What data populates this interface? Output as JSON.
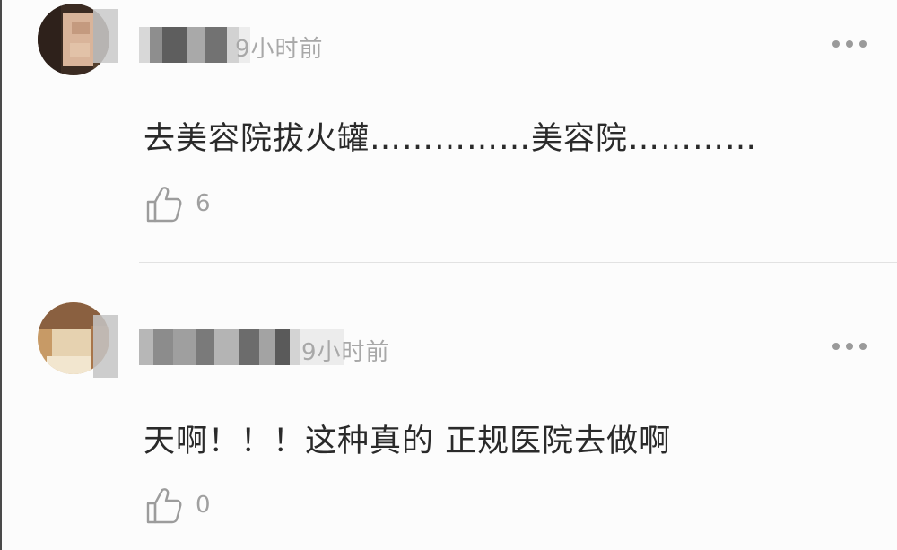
{
  "comments": [
    {
      "time": "9小时前",
      "content": "去美容院拔火罐……………美容院…………",
      "likes": "6",
      "more_icon": "ellipsis-icon",
      "like_icon": "thumbs-up-icon"
    },
    {
      "time": "9小时前",
      "content": "天啊！！！这种真的 正规医院去做啊",
      "likes": "0",
      "more_icon": "ellipsis-icon",
      "like_icon": "thumbs-up-icon"
    }
  ],
  "colors": {
    "background": "#fcfcfc",
    "text": "#2a2a2a",
    "muted": "#a8a8a8",
    "divider": "#e2e2e2"
  }
}
